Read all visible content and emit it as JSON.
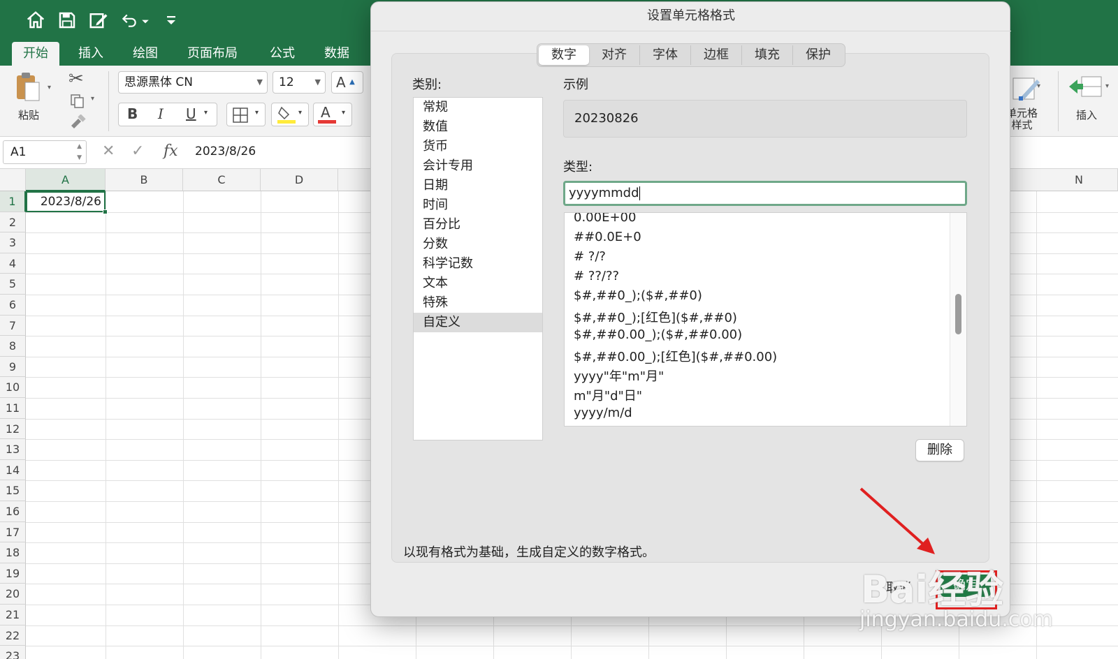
{
  "ribbon_tabs": [
    "开始",
    "插入",
    "绘图",
    "页面布局",
    "公式",
    "数据"
  ],
  "ribbon": {
    "paste_label": "粘贴",
    "font_name": "思源黑体 CN",
    "font_size": "12",
    "bold": "B",
    "italic": "I",
    "underline": "U",
    "font_color_glyph": "A",
    "grow_font_glyph": "A",
    "cell_style_label_line1": "单元格",
    "cell_style_label_line2": "样式",
    "insert_label": "插入",
    "accent_color": "#217346",
    "highlight_color": "#ffeb3b",
    "font_color": "#e53935"
  },
  "formula_bar": {
    "name_box": "A1",
    "fx": "fx",
    "value": "2023/8/26"
  },
  "sheet": {
    "columns": [
      "A",
      "B",
      "C",
      "D",
      "N"
    ],
    "rows": [
      "1",
      "2",
      "3",
      "4",
      "5",
      "6",
      "7",
      "8",
      "9",
      "10",
      "11",
      "12",
      "13",
      "14",
      "15",
      "16",
      "17",
      "18",
      "19",
      "20",
      "21",
      "22",
      "23"
    ],
    "a1_value": "2023/8/26"
  },
  "dialog": {
    "title": "设置单元格格式",
    "tabs": [
      "数字",
      "对齐",
      "字体",
      "边框",
      "填充",
      "保护"
    ],
    "active_tab": "数字",
    "category_label": "类别:",
    "categories": [
      "常规",
      "数值",
      "货币",
      "会计专用",
      "日期",
      "时间",
      "百分比",
      "分数",
      "科学记数",
      "文本",
      "特殊",
      "自定义"
    ],
    "selected_category": "自定义",
    "sample_label": "示例",
    "sample_value": "20230826",
    "type_label": "类型:",
    "type_value": "yyyymmdd",
    "type_list": [
      "0.00E+00",
      "##0.0E+0",
      "# ?/?",
      "# ??/??",
      "$#,##0_);($#,##0)",
      "$#,##0_);[红色]($#,##0)",
      "$#,##0.00_);($#,##0.00)",
      "$#,##0.00_);[红色]($#,##0.00)",
      "yyyy\"年\"m\"月\"",
      "m\"月\"d\"日\"",
      "yyyy/m/d"
    ],
    "delete_button": "删除",
    "hint": "以现有格式为基础，生成自定义的数字格式。",
    "cancel_button": "取消",
    "ok_button": "确定"
  },
  "watermark": {
    "line1": "Bai经验",
    "line2": "jingyan.baidu.com"
  }
}
